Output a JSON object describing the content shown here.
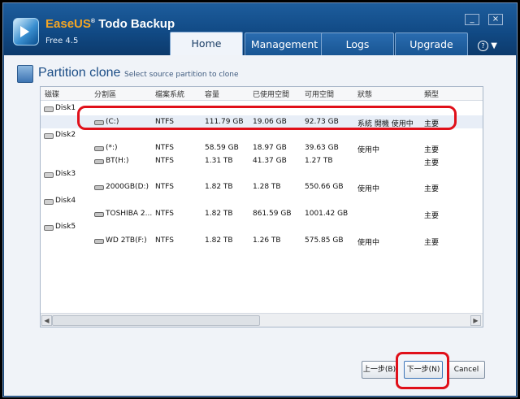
{
  "app": {
    "brand_main": "EaseUS",
    "brand_rest": "Todo Backup",
    "version": "Free 4.5"
  },
  "window_buttons": {
    "minimize": "_",
    "close": "×"
  },
  "tabs": [
    {
      "label": "Home",
      "active": true
    },
    {
      "label": "Management",
      "active": false
    },
    {
      "label": "Logs",
      "active": false
    },
    {
      "label": "Upgrade",
      "active": false
    }
  ],
  "help_label": "?",
  "page": {
    "title": "Partition clone",
    "subtitle": "Select source partition to clone"
  },
  "table": {
    "columns": [
      "磁碟",
      "分割區",
      "檔案系統",
      "容量",
      "已使用空間",
      "可用空間",
      "狀態",
      "類型"
    ],
    "rows": [
      {
        "kind": "disk",
        "name": "Disk1"
      },
      {
        "kind": "part",
        "name": "(C:)",
        "fs": "NTFS",
        "capacity": "111.79 GB",
        "used": "19.06 GB",
        "free": "92.73 GB",
        "status": "系統 開機 使用中",
        "type": "主要",
        "selected": true
      },
      {
        "kind": "disk",
        "name": "Disk2"
      },
      {
        "kind": "part",
        "name": "(*:)",
        "fs": "NTFS",
        "capacity": "58.59 GB",
        "used": "18.97 GB",
        "free": "39.63 GB",
        "status": "使用中",
        "type": "主要"
      },
      {
        "kind": "part",
        "name": "BT(H:)",
        "fs": "NTFS",
        "capacity": "1.31 TB",
        "used": "41.37 GB",
        "free": "1.27 TB",
        "status": "",
        "type": "主要"
      },
      {
        "kind": "disk",
        "name": "Disk3"
      },
      {
        "kind": "part",
        "name": "2000GB(D:)",
        "fs": "NTFS",
        "capacity": "1.82 TB",
        "used": "1.28 TB",
        "free": "550.66 GB",
        "status": "使用中",
        "type": "主要"
      },
      {
        "kind": "disk",
        "name": "Disk4"
      },
      {
        "kind": "part",
        "name": "TOSHIBA 2...",
        "fs": "NTFS",
        "capacity": "1.82 TB",
        "used": "861.59 GB",
        "free": "1001.42 GB",
        "status": "",
        "type": "主要"
      },
      {
        "kind": "disk",
        "name": "Disk5"
      },
      {
        "kind": "part",
        "name": "WD 2TB(F:)",
        "fs": "NTFS",
        "capacity": "1.82 TB",
        "used": "1.26 TB",
        "free": "575.85 GB",
        "status": "使用中",
        "type": "主要"
      }
    ]
  },
  "buttons": {
    "back": "上一步(B)",
    "next": "下一步(N)",
    "cancel": "Cancel"
  }
}
